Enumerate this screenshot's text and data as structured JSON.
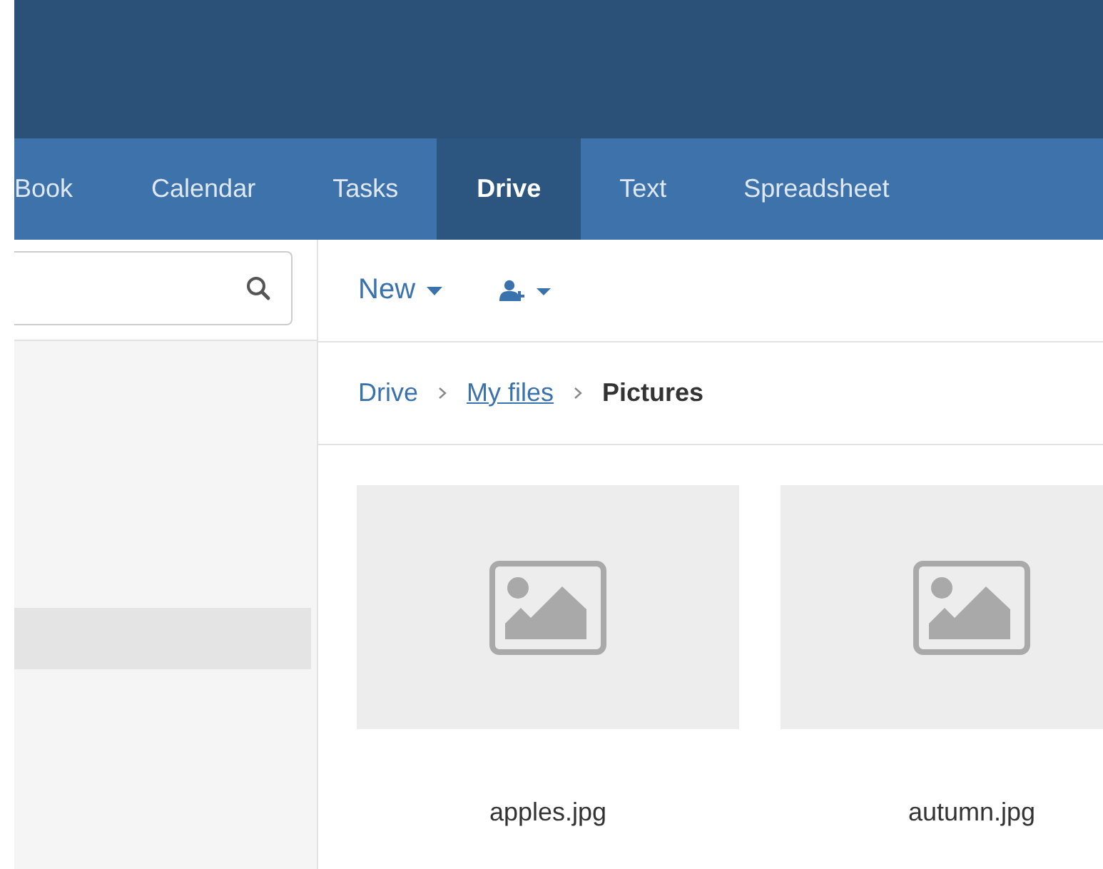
{
  "tabs": [
    {
      "label": "Book",
      "selected": false
    },
    {
      "label": "Calendar",
      "selected": false
    },
    {
      "label": "Tasks",
      "selected": false
    },
    {
      "label": "Drive",
      "selected": true
    },
    {
      "label": "Text",
      "selected": false
    },
    {
      "label": "Spreadsheet",
      "selected": false
    }
  ],
  "toolbar": {
    "new_button": "New"
  },
  "breadcrumb": [
    {
      "label": "Drive",
      "kind": "link"
    },
    {
      "label": "My files",
      "kind": "underlined"
    },
    {
      "label": "Pictures",
      "kind": "current"
    }
  ],
  "files": [
    {
      "name": "apples.jpg"
    },
    {
      "name": "autumn.jpg"
    }
  ]
}
